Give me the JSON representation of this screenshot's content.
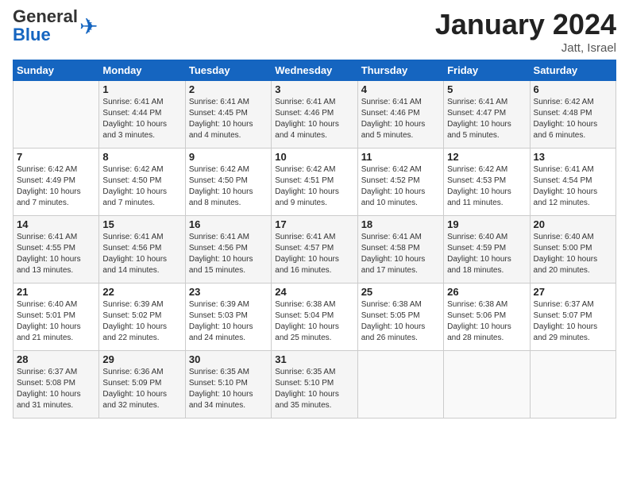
{
  "header": {
    "logo_general": "General",
    "logo_blue": "Blue",
    "month_title": "January 2024",
    "location": "Jatt, Israel"
  },
  "days_of_week": [
    "Sunday",
    "Monday",
    "Tuesday",
    "Wednesday",
    "Thursday",
    "Friday",
    "Saturday"
  ],
  "weeks": [
    [
      {
        "day": "",
        "info": ""
      },
      {
        "day": "1",
        "info": "Sunrise: 6:41 AM\nSunset: 4:44 PM\nDaylight: 10 hours\nand 3 minutes."
      },
      {
        "day": "2",
        "info": "Sunrise: 6:41 AM\nSunset: 4:45 PM\nDaylight: 10 hours\nand 4 minutes."
      },
      {
        "day": "3",
        "info": "Sunrise: 6:41 AM\nSunset: 4:46 PM\nDaylight: 10 hours\nand 4 minutes."
      },
      {
        "day": "4",
        "info": "Sunrise: 6:41 AM\nSunset: 4:46 PM\nDaylight: 10 hours\nand 5 minutes."
      },
      {
        "day": "5",
        "info": "Sunrise: 6:41 AM\nSunset: 4:47 PM\nDaylight: 10 hours\nand 5 minutes."
      },
      {
        "day": "6",
        "info": "Sunrise: 6:42 AM\nSunset: 4:48 PM\nDaylight: 10 hours\nand 6 minutes."
      }
    ],
    [
      {
        "day": "7",
        "info": "Sunrise: 6:42 AM\nSunset: 4:49 PM\nDaylight: 10 hours\nand 7 minutes."
      },
      {
        "day": "8",
        "info": "Sunrise: 6:42 AM\nSunset: 4:50 PM\nDaylight: 10 hours\nand 7 minutes."
      },
      {
        "day": "9",
        "info": "Sunrise: 6:42 AM\nSunset: 4:50 PM\nDaylight: 10 hours\nand 8 minutes."
      },
      {
        "day": "10",
        "info": "Sunrise: 6:42 AM\nSunset: 4:51 PM\nDaylight: 10 hours\nand 9 minutes."
      },
      {
        "day": "11",
        "info": "Sunrise: 6:42 AM\nSunset: 4:52 PM\nDaylight: 10 hours\nand 10 minutes."
      },
      {
        "day": "12",
        "info": "Sunrise: 6:42 AM\nSunset: 4:53 PM\nDaylight: 10 hours\nand 11 minutes."
      },
      {
        "day": "13",
        "info": "Sunrise: 6:41 AM\nSunset: 4:54 PM\nDaylight: 10 hours\nand 12 minutes."
      }
    ],
    [
      {
        "day": "14",
        "info": "Sunrise: 6:41 AM\nSunset: 4:55 PM\nDaylight: 10 hours\nand 13 minutes."
      },
      {
        "day": "15",
        "info": "Sunrise: 6:41 AM\nSunset: 4:56 PM\nDaylight: 10 hours\nand 14 minutes."
      },
      {
        "day": "16",
        "info": "Sunrise: 6:41 AM\nSunset: 4:56 PM\nDaylight: 10 hours\nand 15 minutes."
      },
      {
        "day": "17",
        "info": "Sunrise: 6:41 AM\nSunset: 4:57 PM\nDaylight: 10 hours\nand 16 minutes."
      },
      {
        "day": "18",
        "info": "Sunrise: 6:41 AM\nSunset: 4:58 PM\nDaylight: 10 hours\nand 17 minutes."
      },
      {
        "day": "19",
        "info": "Sunrise: 6:40 AM\nSunset: 4:59 PM\nDaylight: 10 hours\nand 18 minutes."
      },
      {
        "day": "20",
        "info": "Sunrise: 6:40 AM\nSunset: 5:00 PM\nDaylight: 10 hours\nand 20 minutes."
      }
    ],
    [
      {
        "day": "21",
        "info": "Sunrise: 6:40 AM\nSunset: 5:01 PM\nDaylight: 10 hours\nand 21 minutes."
      },
      {
        "day": "22",
        "info": "Sunrise: 6:39 AM\nSunset: 5:02 PM\nDaylight: 10 hours\nand 22 minutes."
      },
      {
        "day": "23",
        "info": "Sunrise: 6:39 AM\nSunset: 5:03 PM\nDaylight: 10 hours\nand 24 minutes."
      },
      {
        "day": "24",
        "info": "Sunrise: 6:38 AM\nSunset: 5:04 PM\nDaylight: 10 hours\nand 25 minutes."
      },
      {
        "day": "25",
        "info": "Sunrise: 6:38 AM\nSunset: 5:05 PM\nDaylight: 10 hours\nand 26 minutes."
      },
      {
        "day": "26",
        "info": "Sunrise: 6:38 AM\nSunset: 5:06 PM\nDaylight: 10 hours\nand 28 minutes."
      },
      {
        "day": "27",
        "info": "Sunrise: 6:37 AM\nSunset: 5:07 PM\nDaylight: 10 hours\nand 29 minutes."
      }
    ],
    [
      {
        "day": "28",
        "info": "Sunrise: 6:37 AM\nSunset: 5:08 PM\nDaylight: 10 hours\nand 31 minutes."
      },
      {
        "day": "29",
        "info": "Sunrise: 6:36 AM\nSunset: 5:09 PM\nDaylight: 10 hours\nand 32 minutes."
      },
      {
        "day": "30",
        "info": "Sunrise: 6:35 AM\nSunset: 5:10 PM\nDaylight: 10 hours\nand 34 minutes."
      },
      {
        "day": "31",
        "info": "Sunrise: 6:35 AM\nSunset: 5:10 PM\nDaylight: 10 hours\nand 35 minutes."
      },
      {
        "day": "",
        "info": ""
      },
      {
        "day": "",
        "info": ""
      },
      {
        "day": "",
        "info": ""
      }
    ]
  ]
}
